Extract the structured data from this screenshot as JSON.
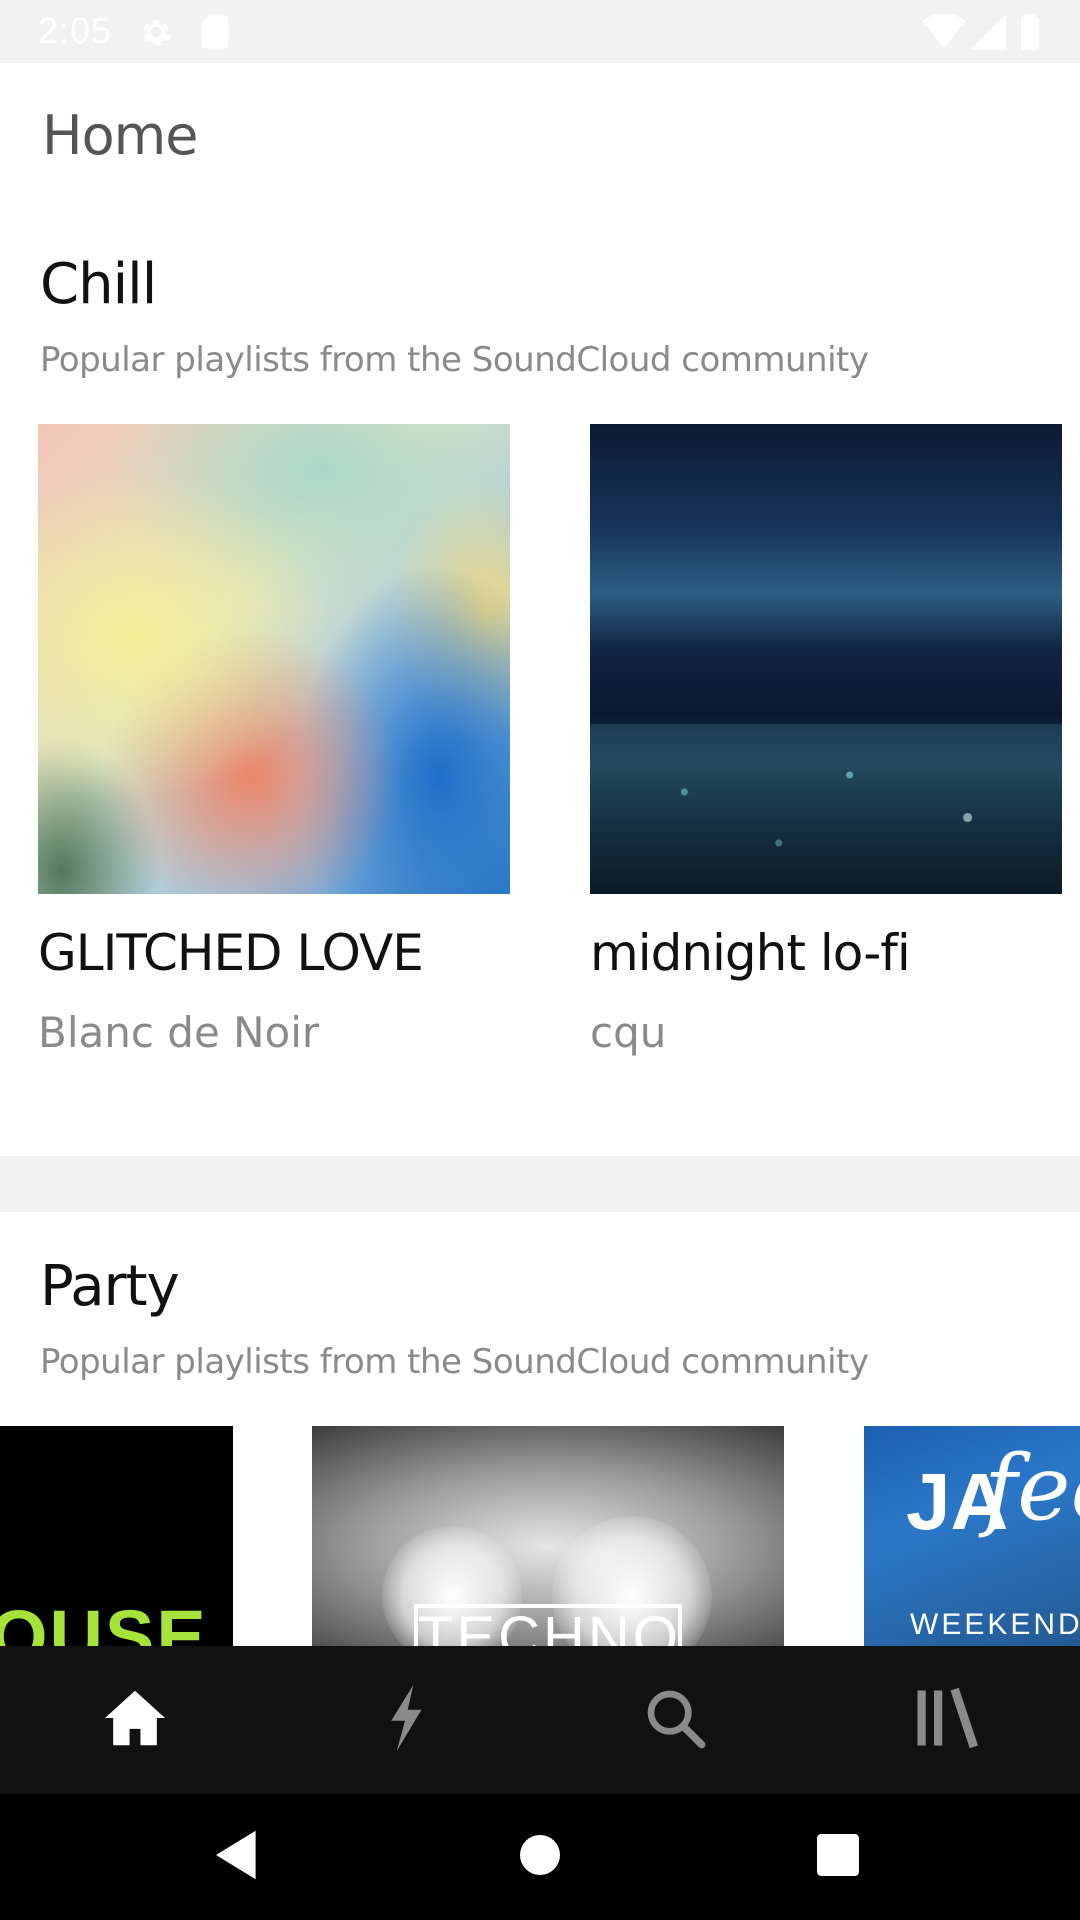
{
  "status_bar": {
    "time": "2:05",
    "icons": [
      "settings-icon",
      "sd-card-icon",
      "wifi-icon",
      "signal-icon",
      "battery-icon"
    ]
  },
  "header": {
    "title": "Home"
  },
  "sections": [
    {
      "title": "Chill",
      "subtitle": "Popular playlists from the SoundCloud community",
      "playlists": [
        {
          "title": "GLITCHED LOVE",
          "artist": "Blanc de Noir"
        },
        {
          "title": "midnight lo-fi",
          "artist": "cqu"
        }
      ]
    },
    {
      "title": "Party",
      "subtitle": "Popular playlists from the SoundCloud community",
      "playlists": [
        {
          "art_text": "OUSE"
        },
        {
          "art_text": "TECHNO"
        },
        {
          "art_text_1": "JA",
          "art_text_2": "fee",
          "art_text_3": "WEEKENDE"
        }
      ]
    }
  ],
  "bottom_nav": {
    "items": [
      "home-icon",
      "stream-icon",
      "search-icon",
      "library-icon"
    ],
    "active": "home-icon",
    "colors": {
      "active": "#ffffff",
      "inactive": "#8a8a8a"
    }
  },
  "system_nav": {
    "buttons": [
      "back-icon",
      "home-circle-icon",
      "recents-icon"
    ]
  }
}
